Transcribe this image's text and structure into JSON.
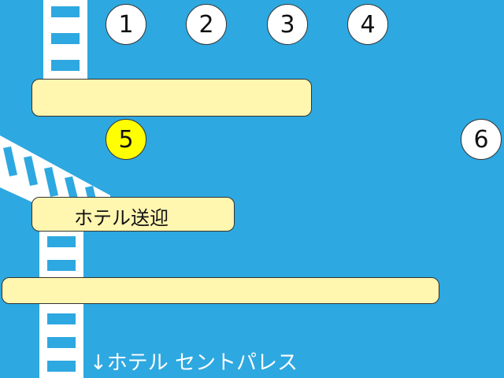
{
  "map": {
    "background_color": "#2ea8e0",
    "platform_color": "#fff6b0",
    "highlight_color": "#ffff00",
    "stops": [
      {
        "number": "1",
        "highlighted": false
      },
      {
        "number": "2",
        "highlighted": false
      },
      {
        "number": "3",
        "highlighted": false
      },
      {
        "number": "4",
        "highlighted": false
      },
      {
        "number": "5",
        "highlighted": true
      },
      {
        "number": "6",
        "highlighted": false
      }
    ],
    "hotel_shuttle_label": "ホテル送迎",
    "direction_label": "↓ホテル セントパレス"
  }
}
